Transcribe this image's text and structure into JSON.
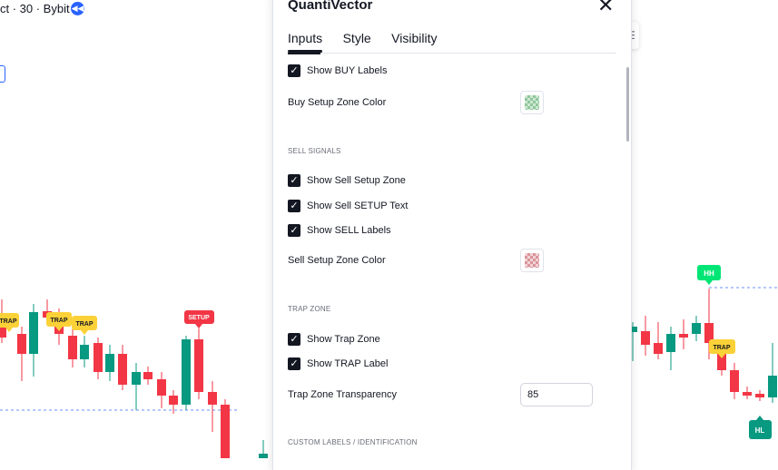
{
  "chart": {
    "header_text": "ct · 30 · Bybit",
    "rewind_icon": "rewind-icon",
    "menu_icon": "hamburger-menu-icon",
    "colors": {
      "bull": "#089981",
      "bear": "#f23645",
      "trap": "#fbd138",
      "setup": "#f23645",
      "hh": "#00e676",
      "hl": "#089981"
    },
    "tags": {
      "trap": "TRAP",
      "setup": "SETUP",
      "hh": "HH",
      "hl": "HL"
    }
  },
  "dialog": {
    "title": "QuantiVector",
    "close_icon": "close-icon",
    "tabs": [
      {
        "label": "Inputs"
      },
      {
        "label": "Style"
      },
      {
        "label": "Visibility"
      }
    ],
    "rows": {
      "show_buy_labels": "Show BUY Labels",
      "buy_zone_color": "Buy Setup Zone Color",
      "sell_signals": "SELL SIGNALS",
      "show_sell_zone": "Show Sell Setup Zone",
      "show_sell_setup_text": "Show Sell SETUP Text",
      "show_sell_labels": "Show SELL Labels",
      "sell_zone_color": "Sell Setup Zone Color",
      "trap_zone_section": "TRAP ZONE",
      "show_trap_zone": "Show Trap Zone",
      "show_trap_label": "Show TRAP Label",
      "trap_transparency": "Trap Zone Transparency",
      "trap_transparency_value": "85",
      "custom_labels_section": "CUSTOM LABELS / IDENTIFICATION"
    },
    "checked_icon": "check-icon",
    "swatch_colors": {
      "buy": "#8fc79a",
      "sell": "#e0a3a8"
    }
  }
}
